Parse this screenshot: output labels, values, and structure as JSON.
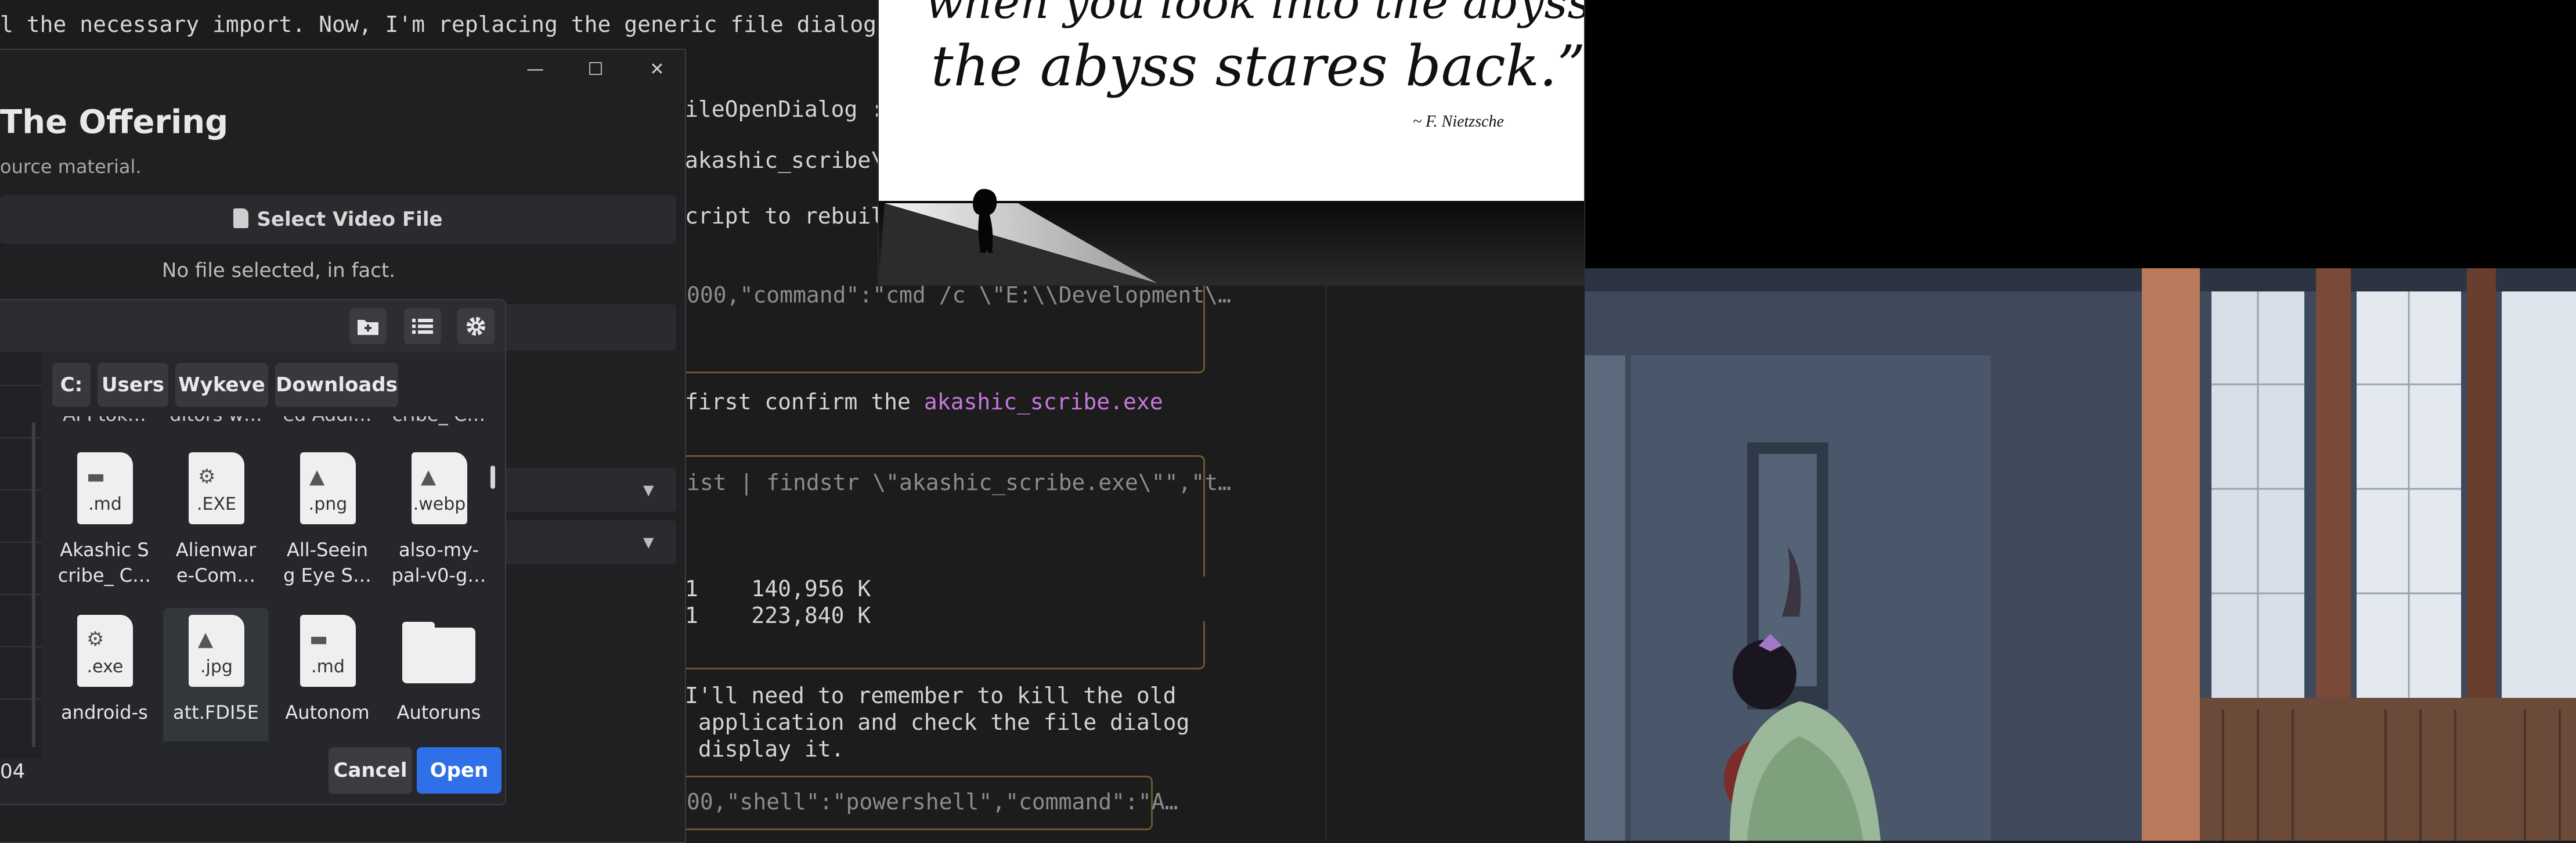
{
  "terminal": {
    "top_line": "l the necessary import. Now, I'm replacing the generic file dialog with a",
    "col2_lines": [
      {
        "text": "ileOpenDialog :=",
        "kind": "plain"
      },
      {
        "text": "akashic_scribe\\gu",
        "kind": "plain"
      },
      {
        "text": "cript to rebuild",
        "kind": "plain"
      }
    ],
    "box1_text": "000,\"command\":\"cmd /c \\\"E:\\\\Development\\…",
    "confirm_prefix": "first confirm the ",
    "confirm_highlight": "akashic_scribe.exe",
    "box2_text": "ist | findstr \\\"akashic_scribe.exe\\\"\",\"t…",
    "mem_lines": [
      "1    140,956 K",
      "1    223,840 K"
    ],
    "note_lines": [
      "I'll need to remember to kill the old",
      " application and check the file dialog",
      " display it."
    ],
    "box3_text": "00,\"shell\":\"powershell\",\"command\":\"A…"
  },
  "quote": {
    "line1": "when you look into the abyss,",
    "line2": "the abyss stares back.”",
    "author": "~ F. Nietzsche"
  },
  "offering_window": {
    "title": "The Offering",
    "subtitle": "ource material.",
    "select_video_label": "Select Video File",
    "no_file_text": "No file selected, in fact.",
    "controls": {
      "minimize": "—",
      "maximize": "☐",
      "close": "✕"
    }
  },
  "file_picker": {
    "breadcrumbs": [
      "C:",
      "Users",
      "Wykeve",
      "Downloads"
    ],
    "partial_top_row": [
      "API tok…",
      "ditors w…",
      "ed Addi…",
      "cribe_ C…"
    ],
    "files": [
      {
        "ext": ".md",
        "glyph": "doc",
        "name_lines": [
          "Akashic S",
          "cribe_ C…"
        ]
      },
      {
        "ext": ".EXE",
        "glyph": "gear",
        "name_lines": [
          "Alienwar",
          "e-Com…"
        ]
      },
      {
        "ext": ".png",
        "glyph": "image",
        "name_lines": [
          "All-Seein",
          "g Eye S…"
        ]
      },
      {
        "ext": ".webp",
        "glyph": "image",
        "name_lines": [
          "also-my-",
          "pal-v0-g…"
        ]
      },
      {
        "ext": ".exe",
        "glyph": "gear",
        "name_lines": [
          "android-s"
        ]
      },
      {
        "ext": ".jpg",
        "glyph": "image",
        "name_lines": [
          "att.FDI5E"
        ]
      },
      {
        "ext": ".md",
        "glyph": "doc",
        "name_lines": [
          "Autonom"
        ]
      },
      {
        "ext": "",
        "glyph": "folder",
        "name_lines": [
          "Autoruns"
        ]
      }
    ],
    "selected_index": 5,
    "filename_partial": "04",
    "cancel_label": "Cancel",
    "open_label": "Open"
  }
}
